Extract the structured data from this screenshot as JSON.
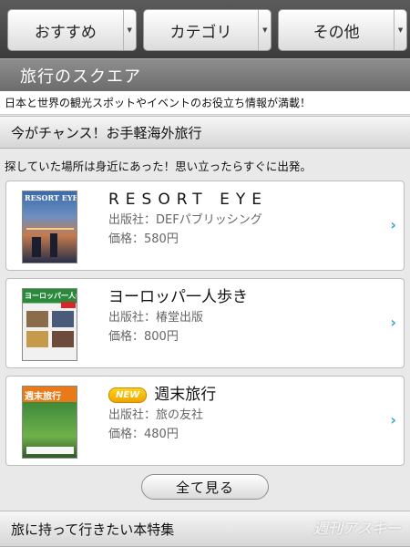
{
  "tabs": [
    {
      "label": "おすすめ"
    },
    {
      "label": "カテゴリ"
    },
    {
      "label": "その他"
    }
  ],
  "app": {
    "title": "旅行のスクエア",
    "tagline": "日本と世界の観光スポットやイベントのお役立ち情報が満載！"
  },
  "section1": {
    "heading": "今がチャンス！お手軽海外旅行",
    "subtext": "探していた場所は身近にあった！思い立ったらすぐに出発。"
  },
  "books": [
    {
      "title": "RESORT EYE",
      "publisher": "出版社：DEFパブリッシング",
      "price": "価格：580円",
      "badge": "",
      "cover_text": "RESORT EYE"
    },
    {
      "title": "ヨーロッパ一人歩き",
      "publisher": "出版社：椿堂出版",
      "price": "価格：800円",
      "badge": "",
      "cover_text": "ヨーロッパ一人歩き"
    },
    {
      "title": "週末旅行",
      "publisher": "出版社：旅の友社",
      "price": "価格：480円",
      "badge": "NEW",
      "cover_text": "週末旅行"
    }
  ],
  "view_all_label": "全て見る",
  "section2": {
    "heading": "旅に持って行きたい本特集"
  },
  "watermark": "週刊アスキー",
  "colors": {
    "accent": "#3ba6c9",
    "badge": "#f0a400",
    "titlebar": "#7c7c7c"
  }
}
